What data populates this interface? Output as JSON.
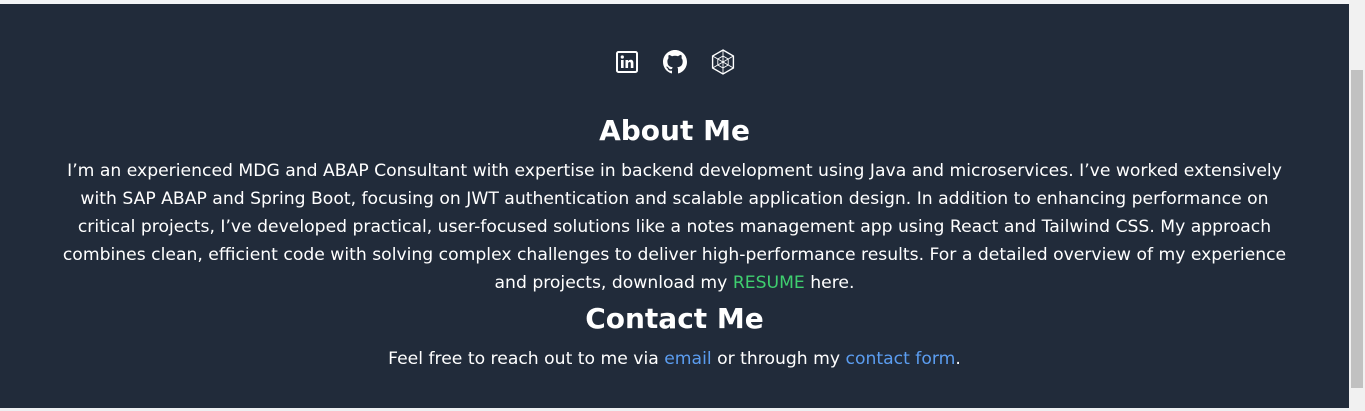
{
  "social": {
    "linkedin_icon": "linkedin-icon",
    "github_icon": "github-icon",
    "portfolio_icon": "hashnode-icon"
  },
  "about": {
    "heading": "About Me",
    "text_before": "I’m an experienced MDG and ABAP Consultant with expertise in backend development using Java and microservices. I’ve worked extensively with SAP ABAP and Spring Boot, focusing on JWT authentication and scalable application design. In addition to enhancing performance on critical projects, I’ve developed practical, user-focused solutions like a notes management app using React and Tailwind CSS. My approach combines clean, efficient code with solving complex challenges to deliver high-performance results. For a detailed overview of my experience and projects, download my ",
    "resume_label": "RESUME",
    "text_after": " here."
  },
  "contact": {
    "heading": "Contact Me",
    "text_before": "Feel free to reach out to me via ",
    "email_label": "email",
    "text_middle": " or through my ",
    "form_label": "contact form",
    "text_after": "."
  },
  "colors": {
    "background": "#212b3a",
    "resume_link": "#3fcf6f",
    "contact_links": "#5b9df0"
  }
}
